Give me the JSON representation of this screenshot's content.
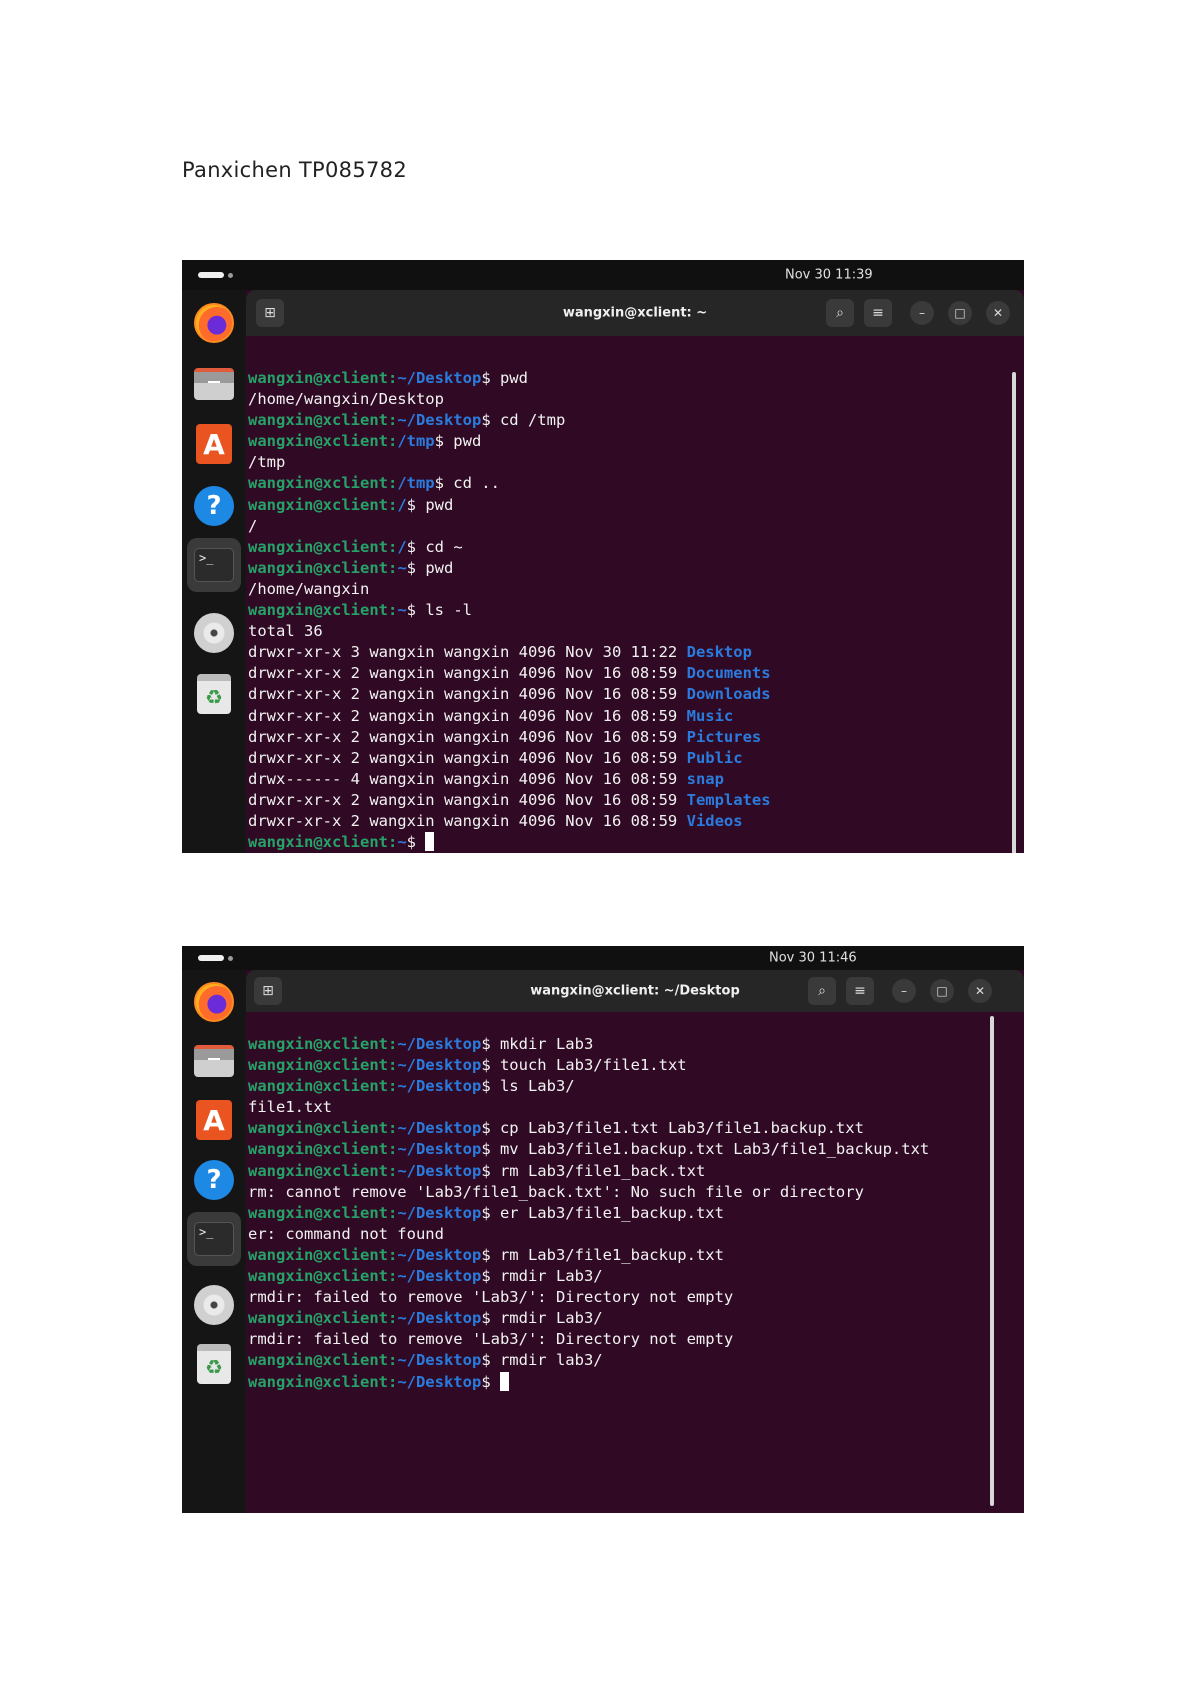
{
  "header": {
    "text": "Panxichen TP085782"
  },
  "screenshots": [
    {
      "clock": "Nov 30  11:39",
      "window_title": "wangxin@xclient: ~",
      "dock_icons": [
        "firefox-icon",
        "files-icon",
        "app-store-icon",
        "help-icon",
        "terminal-icon",
        "disc-icon",
        "trash-icon"
      ],
      "terminal_lines": [
        {
          "user": "wangxin@xclient:",
          "path": "~/Desktop",
          "cmd": "$ pwd"
        },
        {
          "out": "/home/wangxin/Desktop"
        },
        {
          "user": "wangxin@xclient:",
          "path": "~/Desktop",
          "cmd": "$ cd /tmp"
        },
        {
          "user": "wangxin@xclient:",
          "path": "/tmp",
          "cmd": "$ pwd"
        },
        {
          "out": "/tmp"
        },
        {
          "user": "wangxin@xclient:",
          "path": "/tmp",
          "cmd": "$ cd .."
        },
        {
          "user": "wangxin@xclient:",
          "path": "/",
          "cmd": "$ pwd"
        },
        {
          "out": "/"
        },
        {
          "user": "wangxin@xclient:",
          "path": "/",
          "cmd": "$ cd ~"
        },
        {
          "user": "wangxin@xclient:",
          "path": "~",
          "cmd": "$ pwd"
        },
        {
          "out": "/home/wangxin"
        },
        {
          "user": "wangxin@xclient:",
          "path": "~",
          "cmd": "$ ls -l"
        },
        {
          "out": "total 36"
        },
        {
          "out": "drwxr-xr-x 3 wangxin wangxin 4096 Nov 30 11:22 ",
          "dir": "Desktop"
        },
        {
          "out": "drwxr-xr-x 2 wangxin wangxin 4096 Nov 16 08:59 ",
          "dir": "Documents"
        },
        {
          "out": "drwxr-xr-x 2 wangxin wangxin 4096 Nov 16 08:59 ",
          "dir": "Downloads"
        },
        {
          "out": "drwxr-xr-x 2 wangxin wangxin 4096 Nov 16 08:59 ",
          "dir": "Music"
        },
        {
          "out": "drwxr-xr-x 2 wangxin wangxin 4096 Nov 16 08:59 ",
          "dir": "Pictures"
        },
        {
          "out": "drwxr-xr-x 2 wangxin wangxin 4096 Nov 16 08:59 ",
          "dir": "Public"
        },
        {
          "out": "drwx------ 4 wangxin wangxin 4096 Nov 16 08:59 ",
          "dir": "snap"
        },
        {
          "out": "drwxr-xr-x 2 wangxin wangxin 4096 Nov 16 08:59 ",
          "dir": "Templates"
        },
        {
          "out": "drwxr-xr-x 2 wangxin wangxin 4096 Nov 16 08:59 ",
          "dir": "Videos"
        },
        {
          "user": "wangxin@xclient:",
          "path": "~",
          "cmd": "$ ",
          "cursor": true
        }
      ]
    },
    {
      "clock": "Nov 30  11:46",
      "window_title": "wangxin@xclient: ~/Desktop",
      "dock_icons": [
        "firefox-icon",
        "files-icon",
        "app-store-icon",
        "help-icon",
        "terminal-icon",
        "disc-icon",
        "trash-icon"
      ],
      "terminal_lines": [
        {
          "user": "wangxin@xclient:",
          "path": "~/Desktop",
          "cmd": "$ mkdir Lab3"
        },
        {
          "user": "wangxin@xclient:",
          "path": "~/Desktop",
          "cmd": "$ touch Lab3/file1.txt"
        },
        {
          "user": "wangxin@xclient:",
          "path": "~/Desktop",
          "cmd": "$ ls Lab3/"
        },
        {
          "out": "file1.txt"
        },
        {
          "user": "wangxin@xclient:",
          "path": "~/Desktop",
          "cmd": "$ cp Lab3/file1.txt Lab3/file1.backup.txt"
        },
        {
          "user": "wangxin@xclient:",
          "path": "~/Desktop",
          "cmd": "$ mv Lab3/file1.backup.txt Lab3/file1_backup.txt"
        },
        {
          "user": "wangxin@xclient:",
          "path": "~/Desktop",
          "cmd": "$ rm Lab3/file1_back.txt"
        },
        {
          "out": "rm: cannot remove 'Lab3/file1_back.txt': No such file or directory"
        },
        {
          "user": "wangxin@xclient:",
          "path": "~/Desktop",
          "cmd": "$ er Lab3/file1_backup.txt"
        },
        {
          "out": "er: command not found"
        },
        {
          "user": "wangxin@xclient:",
          "path": "~/Desktop",
          "cmd": "$ rm Lab3/file1_backup.txt"
        },
        {
          "user": "wangxin@xclient:",
          "path": "~/Desktop",
          "cmd": "$ rmdir Lab3/"
        },
        {
          "out": "rmdir: failed to remove 'Lab3/': Directory not empty"
        },
        {
          "user": "wangxin@xclient:",
          "path": "~/Desktop",
          "cmd": "$ rmdir Lab3/"
        },
        {
          "out": "rmdir: failed to remove 'Lab3/': Directory not empty"
        },
        {
          "user": "wangxin@xclient:",
          "path": "~/Desktop",
          "cmd": "$ rmdir lab3/"
        },
        {
          "user": "wangxin@xclient:",
          "path": "~/Desktop",
          "cmd": "$ ",
          "cursor": true
        }
      ]
    }
  ]
}
